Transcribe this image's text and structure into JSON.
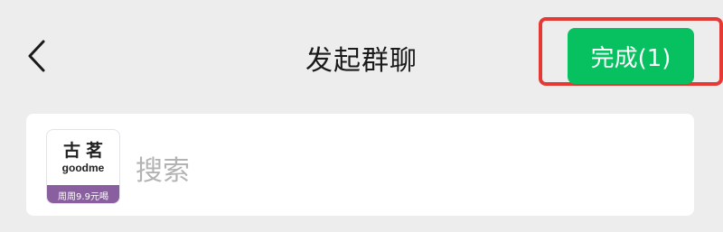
{
  "header": {
    "back_icon": "chevron-left-icon",
    "title": "发起群聊",
    "done_label": "完成(1)"
  },
  "colors": {
    "background": "#ededed",
    "accent_green": "#07c160",
    "highlight_red": "#e53935",
    "placeholder": "#b3b3b3",
    "logo_band": "#8a5fa0"
  },
  "search": {
    "logo": {
      "title_cn": "古茗",
      "title_en": "goodme",
      "band_text": "周周9.9元喝"
    },
    "placeholder": "搜索"
  }
}
